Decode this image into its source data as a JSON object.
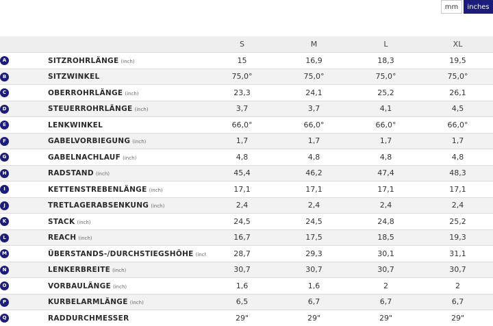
{
  "unit_toggle": {
    "mm_label": "mm",
    "inches_label": "inches",
    "active": "inches"
  },
  "sizes": [
    "S",
    "M",
    "L",
    "XL"
  ],
  "rows": [
    {
      "letter": "A",
      "name": "SITZROHRLÄNGE",
      "unit": "(inch)",
      "values": [
        "15",
        "16,9",
        "18,3",
        "19,5"
      ]
    },
    {
      "letter": "B",
      "name": "SITZWINKEL",
      "unit": "",
      "values": [
        "75,0°",
        "75,0°",
        "75,0°",
        "75,0°"
      ]
    },
    {
      "letter": "C",
      "name": "OBERROHRLÄNGE",
      "unit": "(inch)",
      "values": [
        "23,3",
        "24,1",
        "25,2",
        "26,1"
      ]
    },
    {
      "letter": "D",
      "name": "STEUERROHRLÄNGE",
      "unit": "(inch)",
      "values": [
        "3,7",
        "3,7",
        "4,1",
        "4,5"
      ]
    },
    {
      "letter": "E",
      "name": "LENKWINKEL",
      "unit": "",
      "values": [
        "66,0°",
        "66,0°",
        "66,0°",
        "66,0°"
      ]
    },
    {
      "letter": "F",
      "name": "GABELVORBIEGUNG",
      "unit": "(inch)",
      "values": [
        "1,7",
        "1,7",
        "1,7",
        "1,7"
      ]
    },
    {
      "letter": "G",
      "name": "GABELNACHLAUF",
      "unit": "(inch)",
      "values": [
        "4,8",
        "4,8",
        "4,8",
        "4,8"
      ]
    },
    {
      "letter": "H",
      "name": "RADSTAND",
      "unit": "(inch)",
      "values": [
        "45,4",
        "46,2",
        "47,4",
        "48,3"
      ]
    },
    {
      "letter": "I",
      "name": "KETTENSTREBENLÄNGE",
      "unit": "(inch)",
      "values": [
        "17,1",
        "17,1",
        "17,1",
        "17,1"
      ]
    },
    {
      "letter": "J",
      "name": "TRETLAGERABSENKUNG",
      "unit": "(inch)",
      "values": [
        "2,4",
        "2,4",
        "2,4",
        "2,4"
      ]
    },
    {
      "letter": "K",
      "name": "STACK",
      "unit": "(inch)",
      "values": [
        "24,5",
        "24,5",
        "24,8",
        "25,2"
      ]
    },
    {
      "letter": "L",
      "name": "REACH",
      "unit": "(inch)",
      "values": [
        "16,7",
        "17,5",
        "18,5",
        "19,3"
      ]
    },
    {
      "letter": "M",
      "name": "ÜBERSTANDS-/DURCHSTIEGSHÖHE",
      "unit": "(inch)",
      "values": [
        "28,7",
        "29,3",
        "30,1",
        "31,1"
      ]
    },
    {
      "letter": "N",
      "name": "LENKERBREITE",
      "unit": "(inch)",
      "values": [
        "30,7",
        "30,7",
        "30,7",
        "30,7"
      ]
    },
    {
      "letter": "O",
      "name": "VORBAULÄNGE",
      "unit": "(inch)",
      "values": [
        "1,6",
        "1,6",
        "2",
        "2"
      ]
    },
    {
      "letter": "P",
      "name": "KURBELARMLÄNGE",
      "unit": "(inch)",
      "values": [
        "6,5",
        "6,7",
        "6,7",
        "6,7"
      ]
    },
    {
      "letter": "Q",
      "name": "RADDURCHMESSER",
      "unit": "",
      "values": [
        "29\"",
        "29\"",
        "29\"",
        "29\""
      ]
    }
  ],
  "colors": {
    "accent": "#1c1c7a",
    "header_bg": "#eeeeee",
    "stripe_bg": "#f2f2f2"
  }
}
